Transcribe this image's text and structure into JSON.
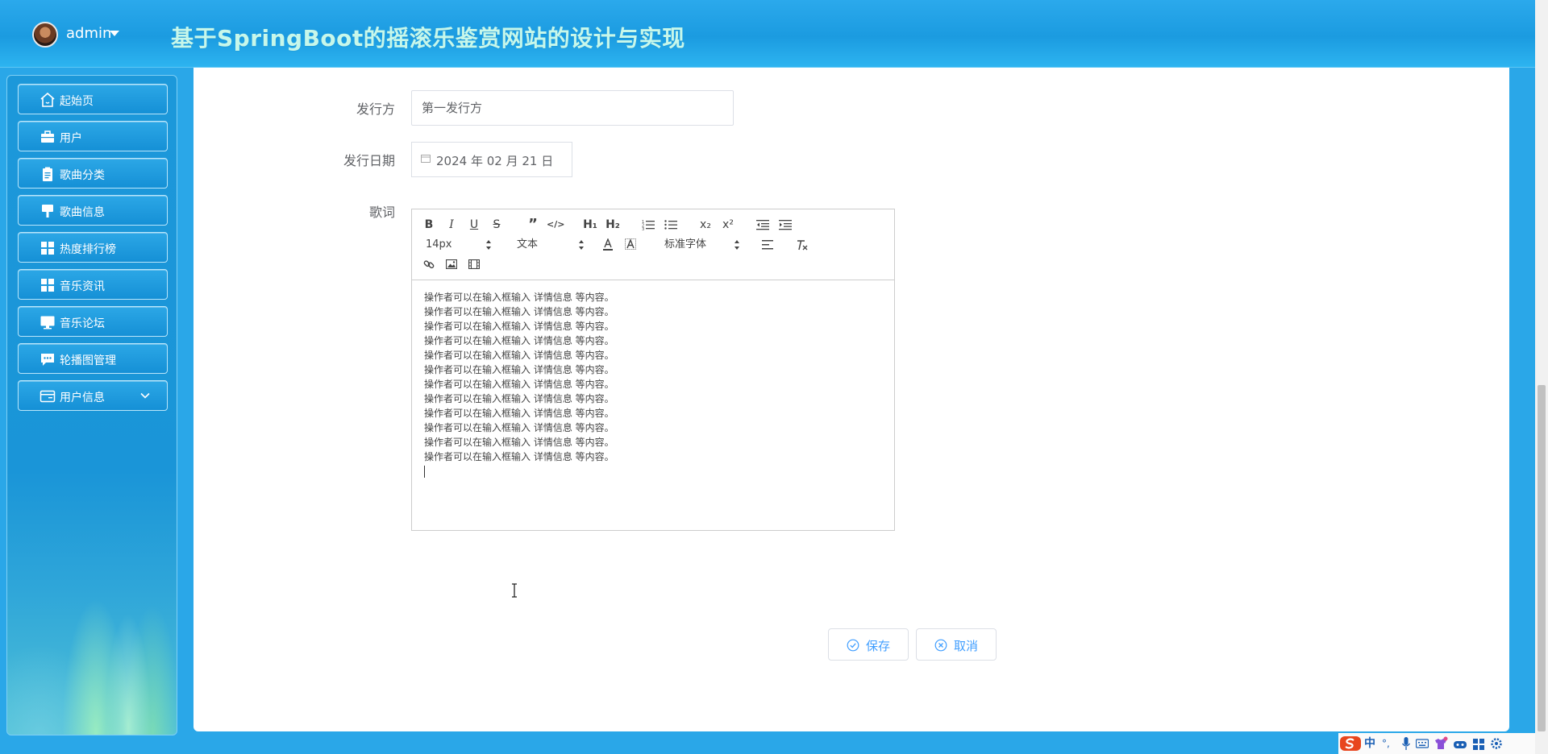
{
  "header": {
    "user_name": "admin",
    "title": "基于SpringBoot的摇滚乐鉴赏网站的设计与实现"
  },
  "sidebar": {
    "items": [
      {
        "label": "起始页",
        "icon": "home-icon"
      },
      {
        "label": "用户",
        "icon": "briefcase-icon"
      },
      {
        "label": "歌曲分类",
        "icon": "clipboard-icon"
      },
      {
        "label": "歌曲信息",
        "icon": "brush-icon"
      },
      {
        "label": "热度排行榜",
        "icon": "grid-icon"
      },
      {
        "label": "音乐资讯",
        "icon": "grid-icon"
      },
      {
        "label": "音乐论坛",
        "icon": "monitor-icon"
      },
      {
        "label": "轮播图管理",
        "icon": "chat-icon"
      },
      {
        "label": "用户信息",
        "icon": "card-icon"
      }
    ]
  },
  "form": {
    "publisher_label": "发行方",
    "publisher_value": "第一发行方",
    "date_label": "发行日期",
    "date_value": "2024 年 02 月 21 日",
    "lyrics_label": "歌词"
  },
  "editor": {
    "toolbar": {
      "bold": "B",
      "italic": "I",
      "underline": "U",
      "strike": "S",
      "quote": "”",
      "code": "</>",
      "h1": "H₁",
      "h2": "H₂",
      "subscript": "x₂",
      "superscript": "x²",
      "font_size": "14px",
      "header_select": "文本",
      "font_family": "标准字体"
    },
    "content_lines": [
      "操作者可以在输入框输入 详情信息 等内容。",
      "操作者可以在输入框输入 详情信息 等内容。",
      "操作者可以在输入框输入 详情信息 等内容。",
      "操作者可以在输入框输入 详情信息 等内容。",
      "操作者可以在输入框输入 详情信息 等内容。",
      "操作者可以在输入框输入 详情信息 等内容。",
      "操作者可以在输入框输入 详情信息 等内容。",
      "操作者可以在输入框输入 详情信息 等内容。",
      "操作者可以在输入框输入 详情信息 等内容。",
      "操作者可以在输入框输入 详情信息 等内容。",
      "操作者可以在输入框输入 详情信息 等内容。",
      "操作者可以在输入框输入 详情信息 等内容。"
    ]
  },
  "buttons": {
    "save": "保存",
    "cancel": "取消"
  },
  "tray": {
    "ime_mode": "中",
    "punct": "°,"
  },
  "colors": {
    "header_bg": "#1b9be0",
    "title_color": "#c7f7ea",
    "accent": "#409eff",
    "menu_bg": "#1590d6"
  }
}
